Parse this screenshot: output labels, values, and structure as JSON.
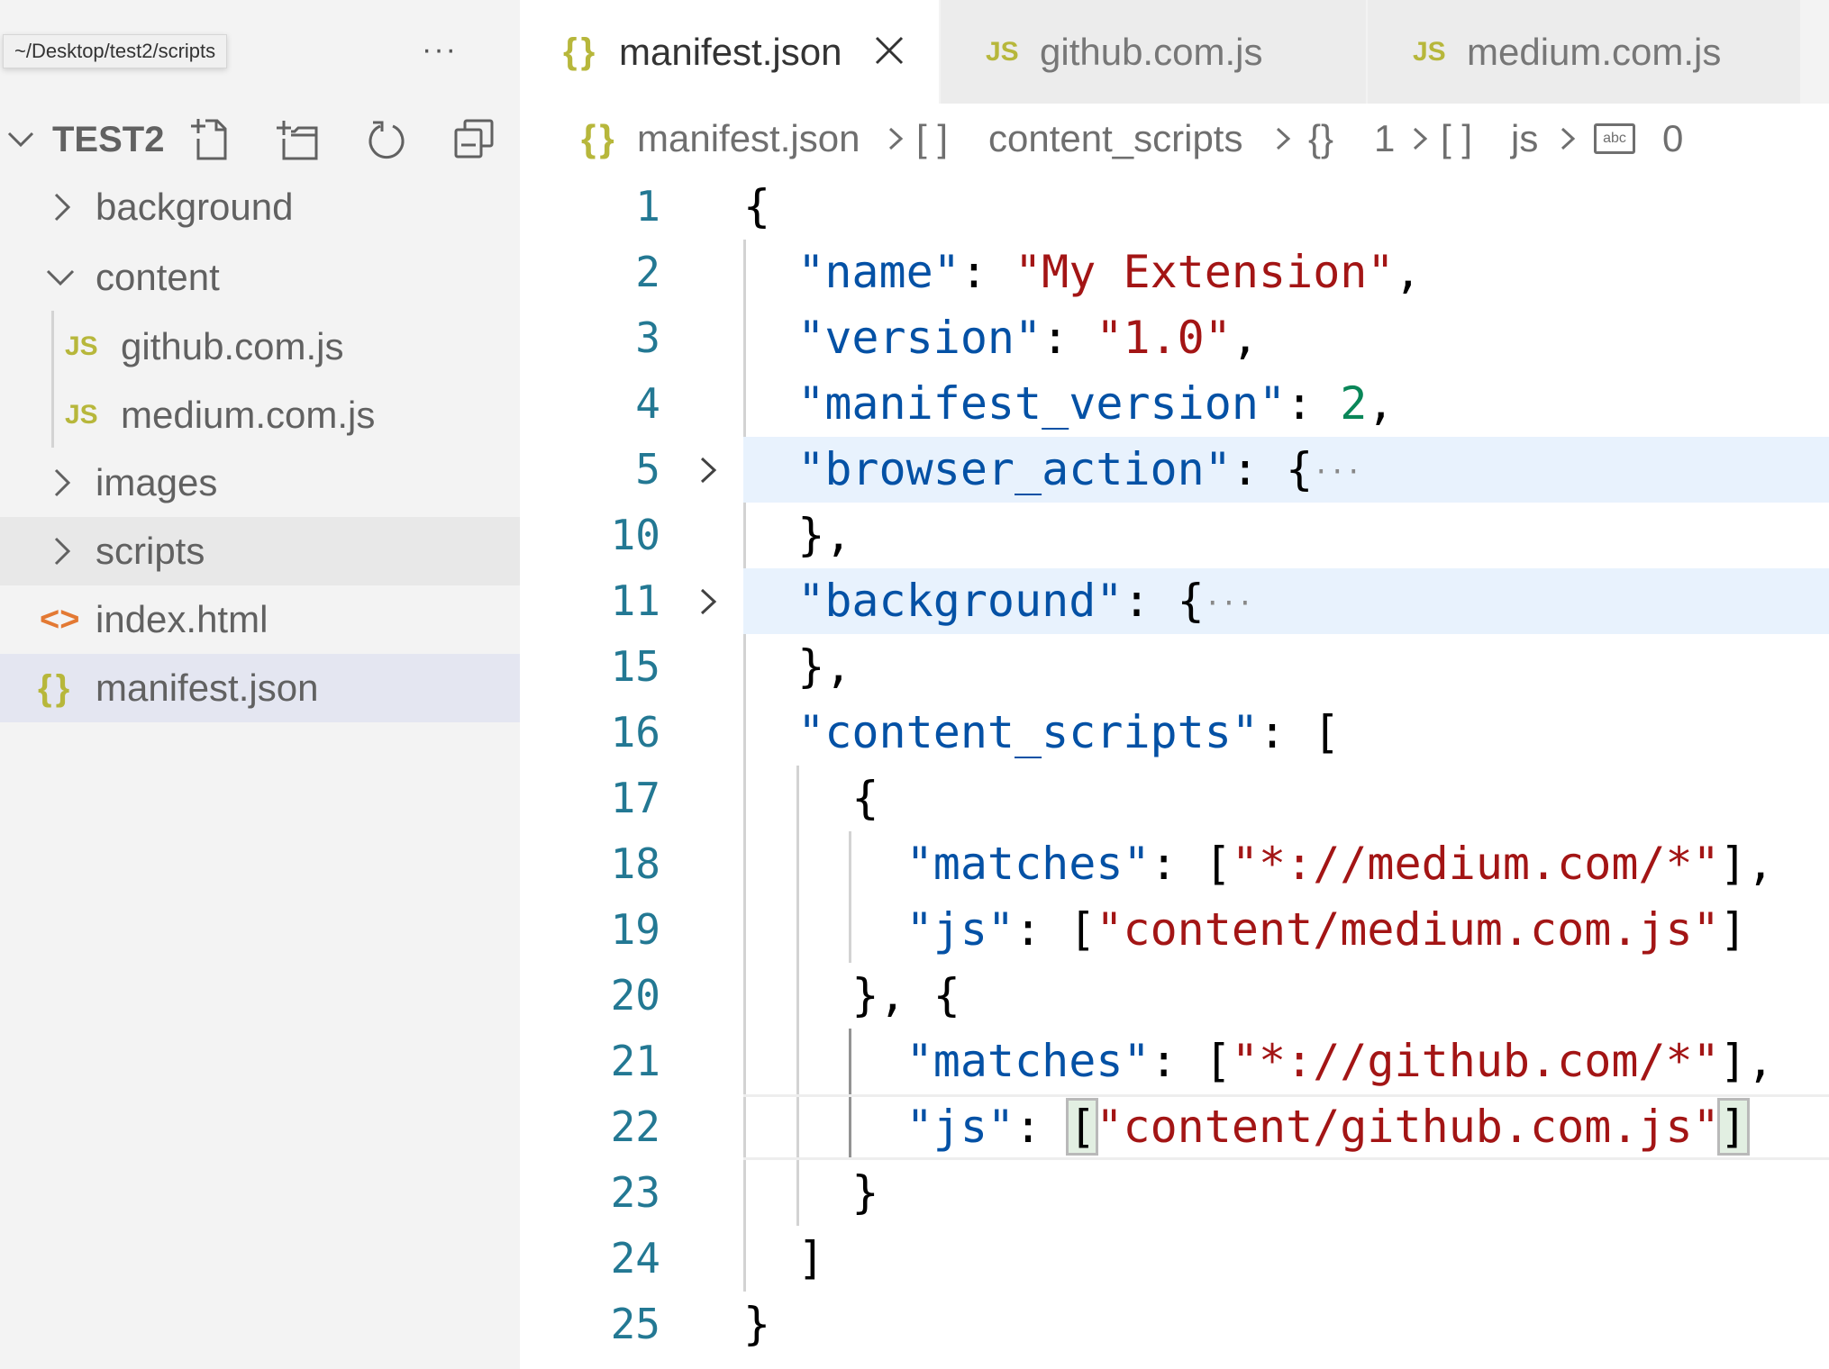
{
  "tooltip": {
    "path": "~/Desktop/test2/scripts"
  },
  "explorer": {
    "more_label": "···",
    "title": "TEST2",
    "actions": [
      "New File",
      "New Folder",
      "Refresh",
      "Collapse All"
    ],
    "tree": [
      {
        "label": "background",
        "type": "folder",
        "expanded": false
      },
      {
        "label": "content",
        "type": "folder",
        "expanded": true
      },
      {
        "label": "github.com.js",
        "type": "js",
        "icon": "JS"
      },
      {
        "label": "medium.com.js",
        "type": "js",
        "icon": "JS"
      },
      {
        "label": "images",
        "type": "folder",
        "expanded": false
      },
      {
        "label": "scripts",
        "type": "folder",
        "expanded": false,
        "hovered": true
      },
      {
        "label": "index.html",
        "type": "html",
        "icon": "<>"
      },
      {
        "label": "manifest.json",
        "type": "json",
        "icon": "{}",
        "selected": true
      }
    ]
  },
  "tabs": [
    {
      "label": "manifest.json",
      "icon": "{}",
      "active": true,
      "close": "×"
    },
    {
      "label": "github.com.js",
      "icon": "JS",
      "active": false
    },
    {
      "label": "medium.com.js",
      "icon": "JS",
      "active": false
    }
  ],
  "breadcrumbs": [
    {
      "icon": "{}",
      "label": "manifest.json"
    },
    {
      "icon": "[ ]",
      "label": "content_scripts"
    },
    {
      "icon": "{}",
      "label": "1"
    },
    {
      "icon": "[ ]",
      "label": "js"
    },
    {
      "icon": "abc",
      "label": "0"
    }
  ],
  "editor": {
    "language": "json",
    "cursor_line": 22,
    "lines": [
      {
        "num": "1"
      },
      {
        "num": "2"
      },
      {
        "num": "3"
      },
      {
        "num": "4"
      },
      {
        "num": "5",
        "folded": true
      },
      {
        "num": "10"
      },
      {
        "num": "11",
        "folded": true
      },
      {
        "num": "15"
      },
      {
        "num": "16"
      },
      {
        "num": "17"
      },
      {
        "num": "18"
      },
      {
        "num": "19"
      },
      {
        "num": "20"
      },
      {
        "num": "21"
      },
      {
        "num": "22"
      },
      {
        "num": "23"
      },
      {
        "num": "24"
      },
      {
        "num": "25"
      }
    ],
    "tokens": {
      "l1_open": "{",
      "l2_key": "\"name\"",
      "l2_colon": ": ",
      "l2_val": "\"My Extension\"",
      "l2_comma": ",",
      "l3_key": "\"version\"",
      "l3_colon": ": ",
      "l3_val": "\"1.0\"",
      "l3_comma": ",",
      "l4_key": "\"manifest_version\"",
      "l4_colon": ": ",
      "l4_val": "2",
      "l4_comma": ",",
      "l5_key": "\"browser_action\"",
      "l5_colon": ": ",
      "l5_open": "{",
      "ellipsis": "···",
      "l10_close": "},",
      "l11_key": "\"background\"",
      "l11_colon": ": ",
      "l11_open": "{",
      "l15_close": "},",
      "l16_key": "\"content_scripts\"",
      "l16_colon": ": ",
      "l16_open": "[",
      "l17_open": "{",
      "l18_key": "\"matches\"",
      "l18_colon": ": ",
      "l18_lb": "[",
      "l18_val": "\"*://medium.com/*\"",
      "l18_rb": "],",
      "l19_key": "\"js\"",
      "l19_colon": ": ",
      "l19_lb": "[",
      "l19_val": "\"content/medium.com.js\"",
      "l19_rb": "]",
      "l20_text": "}, {",
      "l21_key": "\"matches\"",
      "l21_colon": ": ",
      "l21_lb": "[",
      "l21_val": "\"*://github.com/*\"",
      "l21_rb": "],",
      "l22_key": "\"js\"",
      "l22_colon": ": ",
      "l22_lb": "[",
      "l22_val": "\"content/github.com.js\"",
      "l22_rb": "]",
      "l23_close": "}",
      "l24_close": "]",
      "l25_close": "}"
    }
  },
  "colors": {
    "key": "#0451a5",
    "string": "#a31515",
    "number": "#098658",
    "line_number": "#237893",
    "icon_yellow": "#b7b73b",
    "icon_orange": "#e37933",
    "fold_highlight": "#e8f2fd",
    "selection_row": "#e4e6f1"
  }
}
